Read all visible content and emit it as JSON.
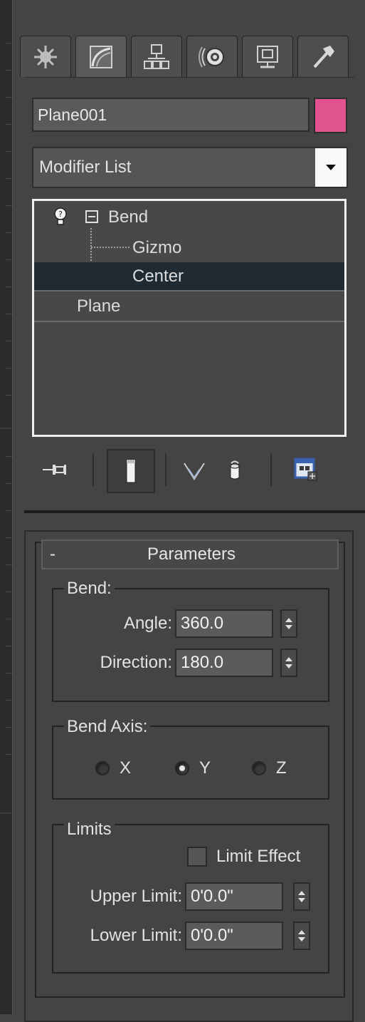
{
  "tabs": [
    {
      "name": "create",
      "icon": "create-icon"
    },
    {
      "name": "modify",
      "icon": "modify-icon",
      "active": true
    },
    {
      "name": "hierarchy",
      "icon": "hierarchy-icon"
    },
    {
      "name": "motion",
      "icon": "motion-icon"
    },
    {
      "name": "display",
      "icon": "display-icon"
    },
    {
      "name": "utilities",
      "icon": "hammer-icon"
    }
  ],
  "object": {
    "name": "Plane001",
    "color": "#e0538f"
  },
  "modifier_list": {
    "selected": "Modifier List"
  },
  "stack": {
    "items": [
      {
        "label": "Bend"
      },
      {
        "label": "Gizmo"
      },
      {
        "label": "Center",
        "selected": true
      },
      {
        "label": "Plane"
      }
    ]
  },
  "rollout": {
    "minus": "-",
    "title": "Parameters",
    "bend": {
      "group_label": "Bend:",
      "angle_label": "Angle:",
      "angle_value": "360.0",
      "direction_label": "Direction:",
      "direction_value": "180.0"
    },
    "bend_axis": {
      "group_label": "Bend Axis:",
      "options": [
        "X",
        "Y",
        "Z"
      ],
      "selected": "Y"
    },
    "limits": {
      "group_label": "Limits",
      "limit_effect_label": "Limit Effect",
      "limit_effect_checked": false,
      "upper_label": "Upper Limit:",
      "upper_value": "0'0.0\"",
      "lower_label": "Lower Limit:",
      "lower_value": "0'0.0\""
    }
  }
}
